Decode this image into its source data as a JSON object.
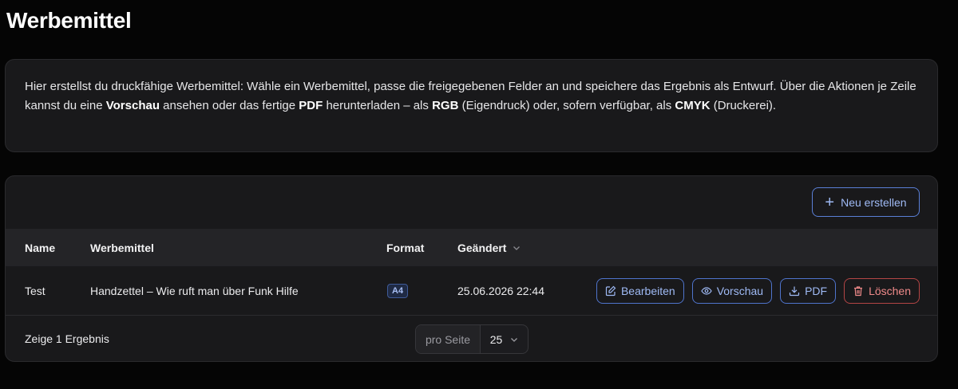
{
  "page": {
    "title": "Werbemittel"
  },
  "info": {
    "t1": "Hier erstellst du druckfähige Werbemittel: Wähle ein Werbemittel, passe die freigegebenen Felder an und speichere das Ergebnis als Entwurf. Über die Aktionen je Zeile kannst du eine ",
    "b1": "Vorschau",
    "t2": " ansehen oder das fertige ",
    "b2": "PDF",
    "t3": " herunterladen – als ",
    "b3": "RGB",
    "t4": " (Eigendruck) oder, sofern verfügbar, als ",
    "b4": "CMYK",
    "t5": " (Druckerei)."
  },
  "toolbar": {
    "create_label": "Neu erstellen"
  },
  "table": {
    "headers": {
      "name": "Name",
      "item": "Werbemittel",
      "format": "Format",
      "changed": "Geändert"
    },
    "rows": [
      {
        "name": "Test",
        "item": "Handzettel – Wie ruft man über Funk Hilfe",
        "format": "A4",
        "changed": "25.06.2026 22:44",
        "actions": {
          "edit": "Bearbeiten",
          "preview": "Vorschau",
          "pdf": "PDF",
          "delete": "Löschen"
        }
      }
    ]
  },
  "footer": {
    "result_text": "Zeige 1 Ergebnis",
    "per_page_label": "pro Seite",
    "per_page_value": "25"
  },
  "colors": {
    "accent": "#9fbaf5",
    "danger": "#f08a8a",
    "background": "#050505",
    "card": "#19191b"
  }
}
